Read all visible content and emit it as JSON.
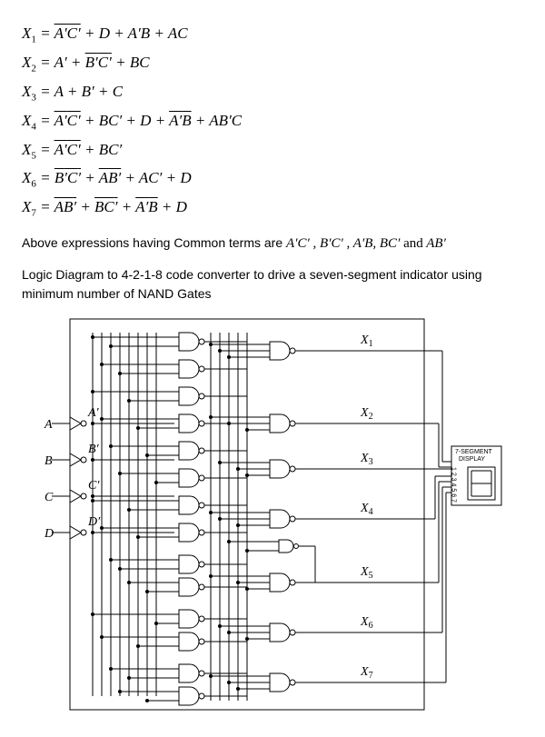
{
  "equations": {
    "x1": {
      "lhs_sym": "X",
      "lhs_idx": "1",
      "rhs_html": "<span class='bar'><span class='p'>A</span>′<span class='p'>C</span>′</span> + <span class='p'>D</span> + <span class='p'>A</span>′<span class='p'>B</span> + <span class='p'>AC</span>"
    },
    "x2": {
      "lhs_sym": "X",
      "lhs_idx": "2",
      "rhs_html": "<span class='p'>A</span>′ + <span class='bar'><span class='p'>B</span>′<span class='p'>C</span>′</span> + <span class='p'>BC</span>"
    },
    "x3": {
      "lhs_sym": "X",
      "lhs_idx": "3",
      "rhs_html": "<span class='p'>A</span> + <span class='p'>B</span>′ + <span class='p'>C</span>"
    },
    "x4": {
      "lhs_sym": "X",
      "lhs_idx": "4",
      "rhs_html": "<span class='bar'><span class='p'>A</span>′<span class='p'>C</span>′</span> + <span class='p'>BC</span>′ + <span class='p'>D</span> + <span class='bar'><span class='p'>A</span>′<span class='p'>B</span></span> + <span class='p'>AB</span>′<span class='p'>C</span>"
    },
    "x5": {
      "lhs_sym": "X",
      "lhs_idx": "5",
      "rhs_html": "<span class='bar'><span class='p'>A</span>′<span class='p'>C</span>′</span> + <span class='p'>BC</span>′"
    },
    "x6": {
      "lhs_sym": "X",
      "lhs_idx": "6",
      "rhs_html": "<span class='bar'><span class='p'>B</span>′<span class='p'>C</span>′</span> + <span class='bar'><span class='p'>AB</span>′</span> + <span class='p'>AC</span>′ + <span class='p'>D</span>"
    },
    "x7": {
      "lhs_sym": "X",
      "lhs_idx": "7",
      "rhs_html": "<span class='bar'><span class='p'>AB</span>′</span> + <span class='bar'><span class='p'>BC</span>′</span> + <span class='bar'><span class='p'>A</span>′<span class='p'>B</span></span> + <span class='p'>D</span>"
    }
  },
  "note_line1_prefix": "Above expressions having Common terms are ",
  "note_line1_terms_html": "<span class='p'>A</span>′<span class='p'>C</span>′ , <span class='p'>B</span>′<span class='p'>C</span>′ , <span class='p'>A</span>′<span class='p'>B</span>, <span class='p'>BC</span>′ <span style='font-style:normal'>and</span> <span class='p'>AB</span>′",
  "note_line2": "Logic Diagram to 4-2-1-8 code converter to drive a seven-segment indicator using minimum number of NAND Gates",
  "diagram": {
    "inputs": {
      "A": "A",
      "A_bar": "A′",
      "B": "B",
      "B_bar": "B′",
      "C": "C",
      "C_bar": "C′",
      "D": "D",
      "D_bar": "D′"
    },
    "outputs": {
      "x1": "X",
      "x2": "X",
      "x3": "X",
      "x4": "X",
      "x5": "X",
      "x6": "X",
      "x7": "X",
      "i1": "1",
      "i2": "2",
      "i3": "3",
      "i4": "4",
      "i5": "5",
      "i6": "6",
      "i7": "7"
    },
    "display_box": {
      "title": "7-SEGMENT",
      "title2": "DISPLAY",
      "pins": "1 2 3 4 5 6 7"
    }
  }
}
